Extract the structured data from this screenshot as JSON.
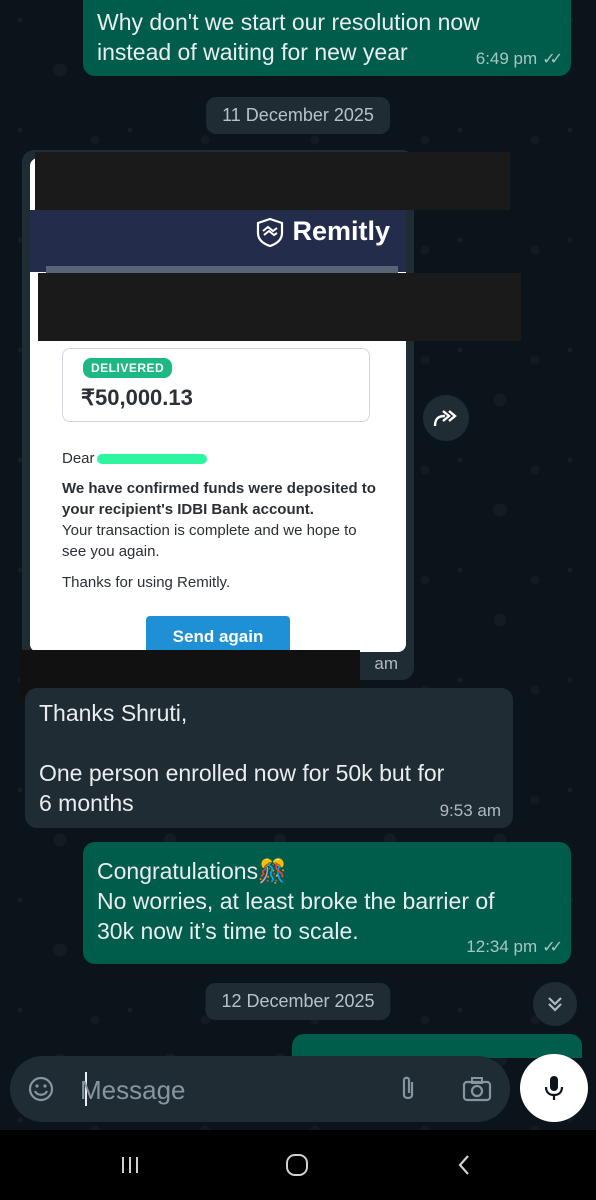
{
  "messages": {
    "m1": {
      "text": "Why don't we start our resolution now\ninstead of waiting for new year",
      "time": "6:49 pm"
    },
    "date1": "11 December 2025",
    "image_msg": {
      "logo_text": "Remitly",
      "status_badge": "DELIVERED",
      "amount": "₹50,000.13",
      "greeting": "Dear",
      "confirm_text": "We have confirmed funds were deposited to your recipient's IDBI Bank account.",
      "complete_text": "Your transaction is complete and we hope to see you again.",
      "thanks_text": "Thanks for using Remitly.",
      "send_again_label": "Send again",
      "time_fragment": "am"
    },
    "m2": {
      "text": "Thanks Shruti,\n\nOne person enrolled now for 50k but for\n6 months",
      "time": "9:53 am"
    },
    "m3": {
      "text": "Congratulations🎊\nNo worries, at least broke the barrier of\n30k now it’s time to scale.",
      "time": "12:34 pm"
    },
    "date2": "12 December 2025"
  },
  "composer": {
    "placeholder": "Message"
  },
  "icons": {
    "read_ticks": "double-check-icon",
    "forward": "forward-icon",
    "scroll_down": "double-chevron-down-icon",
    "emoji": "emoji-icon",
    "attach": "paperclip-icon",
    "camera": "camera-icon",
    "mic": "mic-icon",
    "nav_recents": "recents-icon",
    "nav_home": "home-icon",
    "nav_back": "back-icon"
  },
  "colors": {
    "chat_bg": "#0b141a",
    "outgoing_bubble": "#005c4b",
    "incoming_bubble": "#202c33",
    "remitly_header": "#232d4b",
    "delivered_badge": "#1eb980",
    "send_again_button": "#1f8fd6"
  }
}
